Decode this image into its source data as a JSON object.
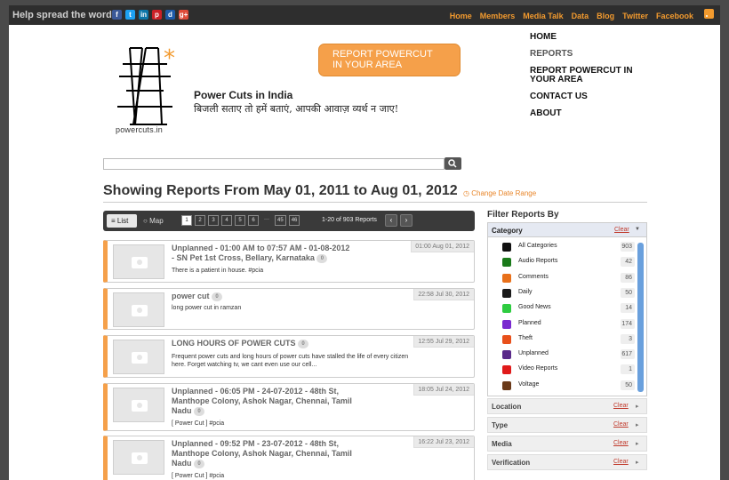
{
  "topbar": {
    "spread_label": "Help spread the word:",
    "social_icons": [
      {
        "name": "facebook-icon",
        "glyph": "f",
        "color": "#3b5998"
      },
      {
        "name": "twitter-icon",
        "glyph": "t",
        "color": "#1da1f2"
      },
      {
        "name": "linkedin-icon",
        "glyph": "in",
        "color": "#0e76a8"
      },
      {
        "name": "pinterest-icon",
        "glyph": "p",
        "color": "#cb2027"
      },
      {
        "name": "digg-icon",
        "glyph": "d",
        "color": "#1d5aa8"
      },
      {
        "name": "googleplus-icon",
        "glyph": "g+",
        "color": "#dd4b39"
      }
    ],
    "nav": [
      "Home",
      "Members",
      "Media Talk",
      "Data",
      "Blog",
      "Twitter",
      "Facebook"
    ]
  },
  "header": {
    "logo_text": "powercuts.in",
    "site_title": "Power Cuts in India",
    "tagline": "बिजली सताए तो हमें बताएं, आपकी आवाज़ व्यर्थ न जाए!",
    "report_button": "REPORT POWERCUT\nIN YOUR AREA",
    "main_nav": [
      "HOME",
      "REPORTS",
      "REPORT POWERCUT IN YOUR AREA",
      "CONTACT US",
      "ABOUT"
    ]
  },
  "search": {
    "placeholder": ""
  },
  "reports": {
    "heading": "Showing Reports From May 01, 2011 to Aug 01, 2012",
    "change_date": "Change Date Range",
    "view_list": "List",
    "view_map": "Map",
    "pages": [
      "1",
      "2",
      "3",
      "4",
      "5",
      "6",
      "···",
      "45",
      "46"
    ],
    "result_count": "1-20 of 903 Reports",
    "prev": "‹",
    "next": "›",
    "items": [
      {
        "title": "Unplanned - 01:00 AM to 07:57 AM - 01-08-2012 - SN Pet 1st Cross, Bellary, Karnataka",
        "comments": "0",
        "date": "01:00 Aug 01, 2012",
        "desc": "There is a patient in house. #pcia"
      },
      {
        "title": "power cut",
        "comments": "0",
        "date": "22:58 Jul 30, 2012",
        "desc": "long power cut in ramzan"
      },
      {
        "title": "LONG HOURS OF POWER CUTS",
        "comments": "0",
        "date": "12:55 Jul 29, 2012",
        "desc": "Frequent power cuts and long hours of power cuts have stalled the life of every citizen here. Forget watching tv, we cant even use our cell..."
      },
      {
        "title": "Unplanned - 06:05 PM - 24-07-2012 - 48th St, Manthope Colony, Ashok Nagar, Chennai, Tamil Nadu",
        "comments": "0",
        "date": "18:05 Jul 24, 2012",
        "desc": "[ Power Cut ] #pcia"
      },
      {
        "title": "Unplanned - 09:52 PM - 23-07-2012 - 48th St, Manthope Colony, Ashok Nagar, Chennai, Tamil Nadu",
        "comments": "0",
        "date": "16:22 Jul 23, 2012",
        "desc": "[ Power Cut ] #pcia"
      }
    ]
  },
  "filters": {
    "title": "Filter Reports By",
    "category_label": "Category",
    "clear": "Clear",
    "categories": [
      {
        "name": "All Categories",
        "count": "903",
        "color": "#111111"
      },
      {
        "name": "Audio Reports",
        "count": "42",
        "color": "#1a7a1a"
      },
      {
        "name": "Comments",
        "count": "86",
        "color": "#e8701a"
      },
      {
        "name": "Daily",
        "count": "50",
        "color": "#1a1a1a"
      },
      {
        "name": "Good News",
        "count": "14",
        "color": "#2ecc40"
      },
      {
        "name": "Planned",
        "count": "174",
        "color": "#7a2ad0"
      },
      {
        "name": "Theft",
        "count": "3",
        "color": "#e8501a"
      },
      {
        "name": "Unplanned",
        "count": "617",
        "color": "#5a2a8a"
      },
      {
        "name": "Video Reports",
        "count": "1",
        "color": "#e01a1a"
      },
      {
        "name": "Voltage",
        "count": "50",
        "color": "#6a3a1a"
      }
    ],
    "sections": [
      "Location",
      "Type",
      "Media",
      "Verification"
    ]
  }
}
